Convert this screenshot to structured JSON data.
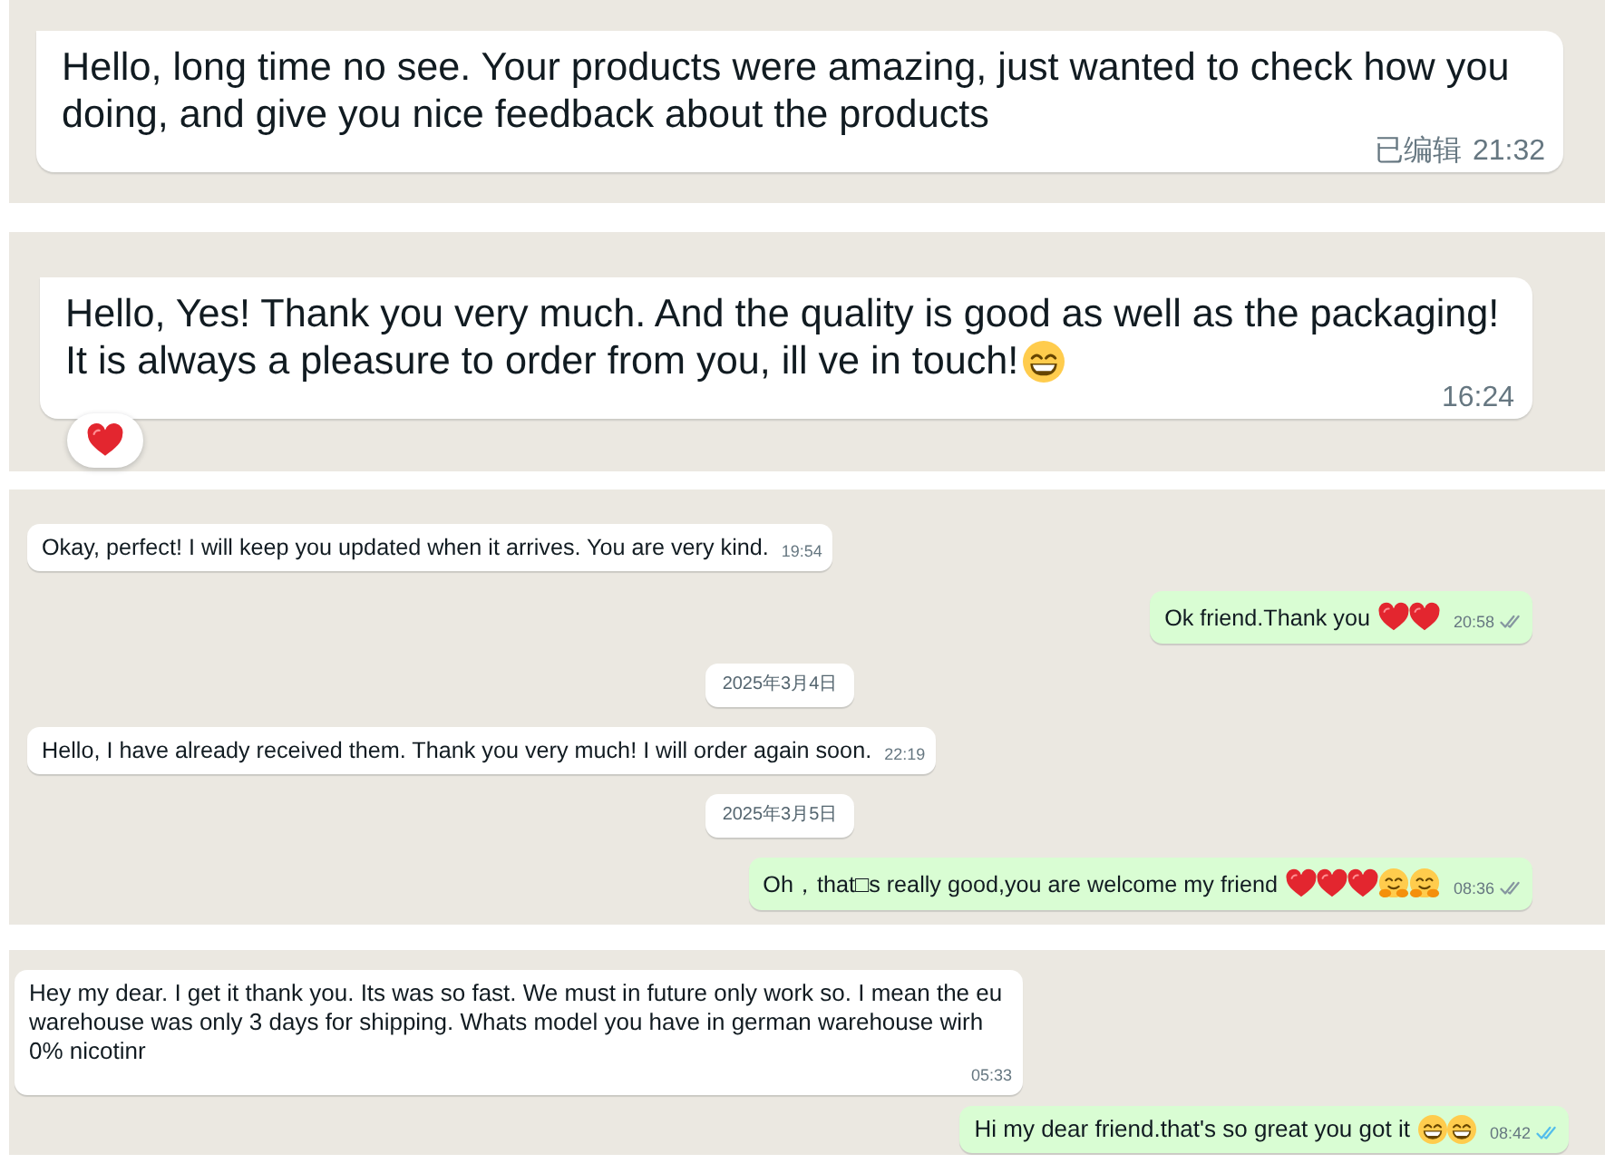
{
  "panels": [
    {
      "messages": [
        {
          "kind": "incoming",
          "lines": [
            "Hello, long time no see. Your products were amazing, just wanted to check how you doing, and give you nice feedback about the products"
          ],
          "edited_label": "已编辑",
          "time": "21:32"
        }
      ]
    },
    {
      "messages": [
        {
          "kind": "incoming",
          "lines": [
            "Hello, Yes! Thank you very much. And the quality is good as well as the packaging!",
            "It is always a pleasure to order from you, ill ve in touch!"
          ],
          "emojis": [
            {
              "kind": "grin"
            }
          ],
          "time": "16:24",
          "reaction": {
            "kind": "heart"
          }
        }
      ]
    },
    {
      "messages": [
        {
          "kind": "incoming",
          "text": "Okay, perfect! I will keep you updated when it arrives. You are very kind.",
          "time": "19:54"
        },
        {
          "kind": "outgoing",
          "text": "Ok friend.Thank you",
          "emojis": [
            {
              "kind": "heart"
            },
            {
              "kind": "heart"
            }
          ],
          "time": "20:58",
          "read": false
        },
        {
          "kind": "date",
          "text": "2025年3月4日"
        },
        {
          "kind": "incoming",
          "text": "Hello, I have already received them. Thank you very much! I will order again soon.",
          "time": "22:19"
        },
        {
          "kind": "date",
          "text": "2025年3月5日"
        },
        {
          "kind": "outgoing",
          "text": "Oh，that□s really good,you are welcome my friend",
          "emojis": [
            {
              "kind": "heart"
            },
            {
              "kind": "heart"
            },
            {
              "kind": "heart"
            },
            {
              "kind": "hug"
            },
            {
              "kind": "hug"
            }
          ],
          "time": "08:36",
          "read": false
        }
      ]
    },
    {
      "messages": [
        {
          "kind": "incoming",
          "text": "Hey my dear. I get it thank you. Its was so fast. We must in future only work so. I mean the eu warehouse was only 3 days for shipping. Whats model you have in german warehouse wirh 0% nicotinr",
          "time": "05:33"
        },
        {
          "kind": "outgoing",
          "text": "Hi my dear friend.that's so great you got it",
          "emojis": [
            {
              "kind": "grin"
            },
            {
              "kind": "grin"
            }
          ],
          "time": "08:42",
          "read": true
        }
      ]
    }
  ]
}
